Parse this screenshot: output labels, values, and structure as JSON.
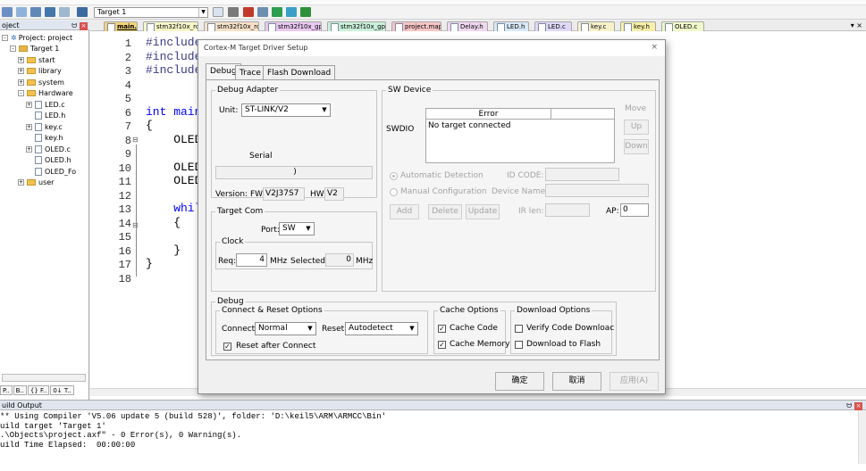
{
  "toolbar": {
    "target": "Target 1"
  },
  "project_panel": {
    "title": "oject",
    "project_label": "Project: project",
    "tree": [
      {
        "label": "Target 1",
        "kind": "target",
        "indent": 1,
        "pm": "-"
      },
      {
        "label": "start",
        "kind": "folder",
        "indent": 2,
        "pm": "+"
      },
      {
        "label": "library",
        "kind": "folder",
        "indent": 2,
        "pm": "+"
      },
      {
        "label": "system",
        "kind": "folder",
        "indent": 2,
        "pm": "+"
      },
      {
        "label": "Hardware",
        "kind": "folder",
        "indent": 2,
        "pm": "-"
      },
      {
        "label": "LED.c",
        "kind": "file",
        "indent": 3,
        "pm": "+"
      },
      {
        "label": "LED.h",
        "kind": "file",
        "indent": 3,
        "pm": ""
      },
      {
        "label": "key.c",
        "kind": "file",
        "indent": 3,
        "pm": "+"
      },
      {
        "label": "key.h",
        "kind": "file",
        "indent": 3,
        "pm": ""
      },
      {
        "label": "OLED.c",
        "kind": "file",
        "indent": 3,
        "pm": "+"
      },
      {
        "label": "OLED.h",
        "kind": "file",
        "indent": 3,
        "pm": ""
      },
      {
        "label": "OLED_Fo",
        "kind": "file",
        "indent": 3,
        "pm": ""
      },
      {
        "label": "user",
        "kind": "folder",
        "indent": 2,
        "pm": "+"
      }
    ],
    "tabs": [
      "P..",
      "B..",
      "{} F..",
      "0↓ T.."
    ]
  },
  "editor": {
    "tabs": [
      {
        "label": "main.c",
        "color": "#f3d27a",
        "active": true
      },
      {
        "label": "stm32f10x_rcc.h",
        "color": "#f6f6c8"
      },
      {
        "label": "stm32f10x_rcc.c",
        "color": "#f6e0c8"
      },
      {
        "label": "stm32f10x_gpio.h",
        "color": "#e8c8f0"
      },
      {
        "label": "stm32f10x_gpio.c",
        "color": "#c8f0d8"
      },
      {
        "label": "project.map",
        "color": "#f7c4c4"
      },
      {
        "label": "Delay.h",
        "color": "#f0d8f0"
      },
      {
        "label": "LED.h",
        "color": "#d8e8f8"
      },
      {
        "label": "LED.c",
        "color": "#e0d8f8"
      },
      {
        "label": "key.c",
        "color": "#f8f0c8"
      },
      {
        "label": "key.h",
        "color": "#f8f0a8"
      },
      {
        "label": "OLED.c",
        "color": "#f0f8c8"
      }
    ],
    "line_numbers": [
      "1",
      "2",
      "3",
      "4",
      "5",
      "6",
      "7",
      "8",
      "9",
      "10",
      "11",
      "12",
      "13",
      "14",
      "15",
      "16",
      "17",
      "18"
    ],
    "code_lines": [
      {
        "line": 1,
        "text": "#include"
      },
      {
        "line": 2,
        "text": "#include"
      },
      {
        "line": 3,
        "text": "#include"
      },
      {
        "line": 6,
        "text": "int main"
      },
      {
        "line": 7,
        "text": "{"
      },
      {
        "line": 8,
        "text": "    OLED"
      },
      {
        "line": 10,
        "text": "    OLED"
      },
      {
        "line": 11,
        "text": "    OLED"
      },
      {
        "line": 13,
        "text": "    whil"
      },
      {
        "line": 14,
        "text": "    {"
      },
      {
        "line": 16,
        "text": "    }"
      },
      {
        "line": 17,
        "text": "}"
      }
    ]
  },
  "dialog": {
    "title": "Cortex-M Target Driver Setup",
    "close": "×",
    "tabs": [
      "Debug",
      "Trace",
      "Flash Download"
    ],
    "debug_adapter": {
      "legend": "Debug Adapter",
      "unit_label": "Unit:",
      "unit_value": "ST-LINK/V2",
      "serial_label": "Serial",
      "serial_value": ")",
      "version_label": "Version: FW:",
      "fw_value": "V2J37S7",
      "hw_label": "HW:",
      "hw_value": "V2"
    },
    "target_com": {
      "legend": "Target Com",
      "port_label": "Port:",
      "port_value": "SW",
      "clock_legend": "Clock",
      "req_label": "Req:",
      "req_value": "4",
      "req_unit": "MHz",
      "selected_label": "Selected:",
      "selected_value": "0",
      "selected_unit": "MHz"
    },
    "sw_device": {
      "legend": "SW Device",
      "col_error": "Error",
      "swdio_label": "SWDIO",
      "message": "No target connected",
      "move": "Move",
      "up": "Up",
      "down": "Down",
      "auto_detect": "Automatic Detection",
      "manual_config": "Manual Configuration",
      "id_code_label": "ID CODE:",
      "device_name_label": "Device Name:",
      "add": "Add",
      "delete": "Delete",
      "update": "Update",
      "ir_len_label": "IR len:",
      "ap_label": "AP:",
      "ap_value": "0"
    },
    "debug_group": {
      "legend": "Debug",
      "connect_reset": {
        "legend": "Connect & Reset Options",
        "connect_label": "Connect:",
        "connect_value": "Normal",
        "reset_label": "Reset:",
        "reset_value": "Autodetect",
        "reset_after_connect": "Reset after Connect"
      },
      "cache_options": {
        "legend": "Cache Options",
        "cache_code": "Cache Code",
        "cache_memory": "Cache Memory"
      },
      "download_options": {
        "legend": "Download Options",
        "verify": "Verify Code Downloac",
        "download_to_flash": "Download to Flash"
      }
    },
    "buttons": {
      "ok": "确定",
      "cancel": "取消",
      "apply": "应用(A)"
    }
  },
  "build_output": {
    "title": "uild Output",
    "lines": [
      "** Using Compiler 'V5.06 update 5 (build 528)', folder: 'D:\\keil5\\ARM\\ARMCC\\Bin'",
      "uild target 'Target 1'",
      ".\\Objects\\project.axf\" - 0 Error(s), 0 Warning(s).",
      "uild Time Elapsed:  00:00:00"
    ]
  },
  "colors": {
    "panel_header": "#dfe6f0",
    "close_red": "#d9534f",
    "keyword_blue": "#0000ff"
  }
}
